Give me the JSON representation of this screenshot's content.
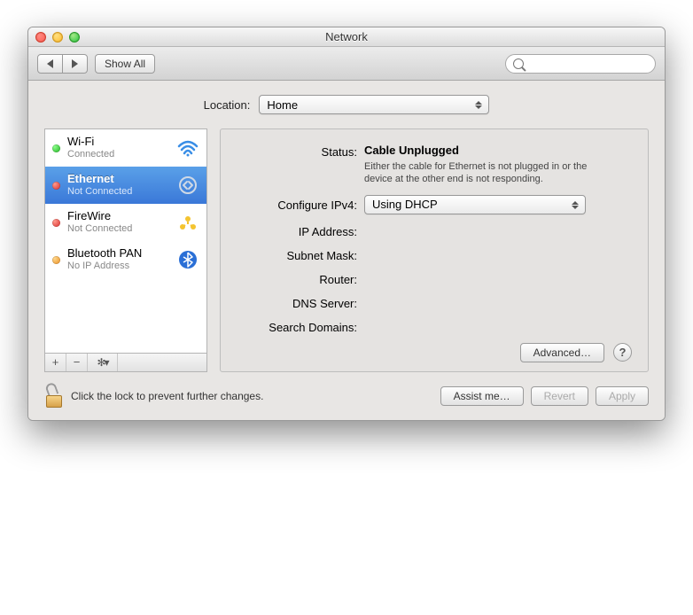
{
  "window": {
    "title": "Network"
  },
  "toolbar": {
    "back": "◀",
    "forward": "▶",
    "show_all": "Show All",
    "search_placeholder": ""
  },
  "location": {
    "label": "Location:",
    "value": "Home"
  },
  "sidebar": {
    "items": [
      {
        "name": "Wi-Fi",
        "sub": "Connected",
        "dot": "green",
        "icon": "wifi"
      },
      {
        "name": "Ethernet",
        "sub": "Not Connected",
        "dot": "red",
        "icon": "ethernet",
        "selected": true
      },
      {
        "name": "FireWire",
        "sub": "Not Connected",
        "dot": "red",
        "icon": "firewire"
      },
      {
        "name": "Bluetooth PAN",
        "sub": "No IP Address",
        "dot": "orange",
        "icon": "bluetooth"
      }
    ],
    "buttons": {
      "add": "+",
      "remove": "−",
      "gear": "✱▾"
    }
  },
  "detail": {
    "status_label": "Status:",
    "status_value": "Cable Unplugged",
    "status_message": "Either the cable for Ethernet is not plugged in or the device at the other end is not responding.",
    "fields": {
      "configure_label": "Configure IPv4:",
      "configure_value": "Using DHCP",
      "ip_label": "IP Address:",
      "ip_value": "",
      "subnet_label": "Subnet Mask:",
      "subnet_value": "",
      "router_label": "Router:",
      "router_value": "",
      "dns_label": "DNS Server:",
      "dns_value": "",
      "search_label": "Search Domains:",
      "search_value": ""
    },
    "advanced": "Advanced…",
    "help": "?"
  },
  "footer": {
    "lock_text": "Click the lock to prevent further changes.",
    "assist": "Assist me…",
    "revert": "Revert",
    "apply": "Apply"
  }
}
